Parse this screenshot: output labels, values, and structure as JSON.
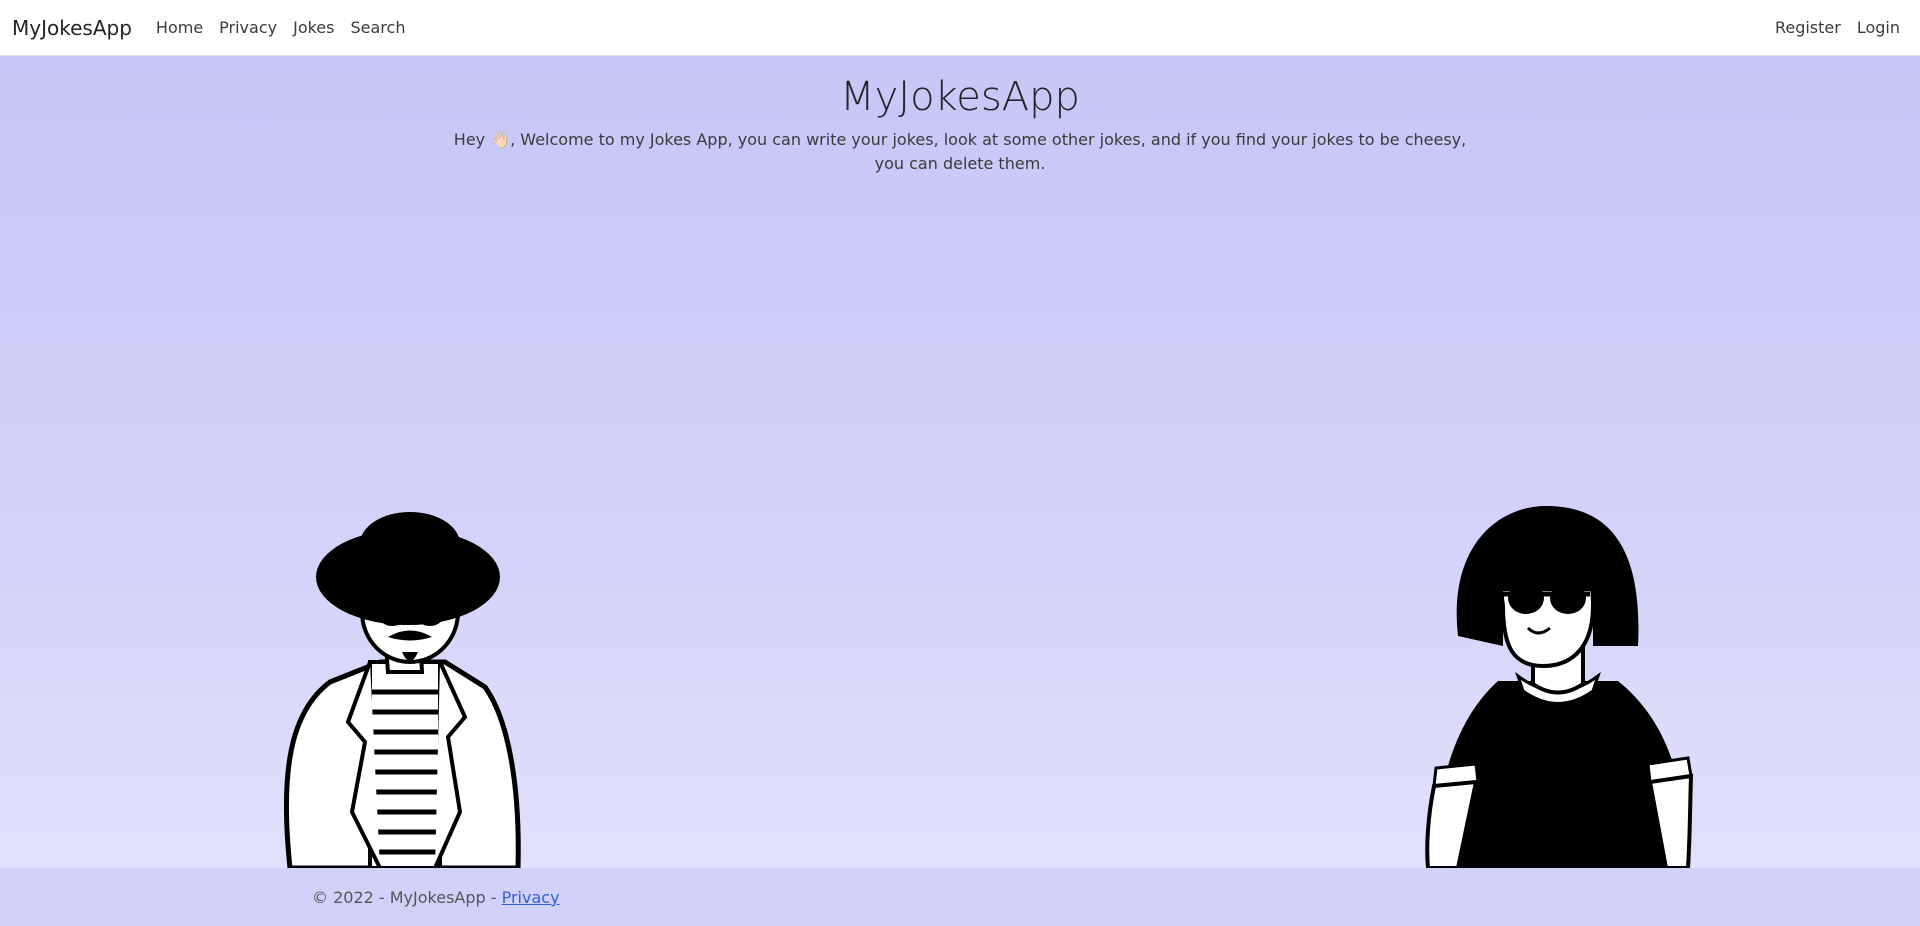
{
  "nav": {
    "brand": "MyJokesApp",
    "links": [
      "Home",
      "Privacy",
      "Jokes",
      "Search"
    ],
    "right_links": [
      "Register",
      "Login"
    ]
  },
  "hero": {
    "title": "MyJokesApp",
    "greeting": "Hey 👋🏻, Welcome to my Jokes App, you can write your jokes, look at some other jokes, and if you find your jokes to be cheesy, you can delete them."
  },
  "footer": {
    "copyright": "© 2022 - MyJokesApp - ",
    "privacy_link": "Privacy"
  },
  "colors": {
    "background_top": "#c7c7f7",
    "background_bottom": "#e1e1fb",
    "link": "#2f60d6"
  }
}
